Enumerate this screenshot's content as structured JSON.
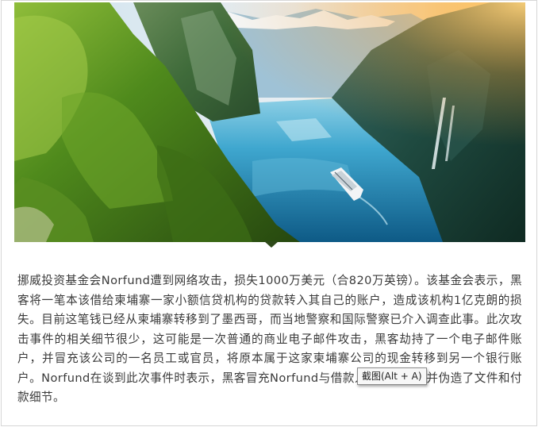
{
  "article": {
    "paragraph": "挪威投资基金会Norfund遭到网络攻击，损失1000万美元（合820万英镑）。该基金会表示，黑客将一笔本该借给柬埔寨一家小额信贷机构的贷款转入其自己的账户，造成该机构1亿克朗的损失。目前这笔钱已经从柬埔寨转移到了墨西哥，而当地警察和国际警察已介入调查此事。此次攻击事件的相关细节很少，这可能是一次普通的商业电子邮件攻击，黑客劫持了一个电子邮件账户，并冒充该公司的一名员工或官员，将原本属于这家柬埔寨公司的现金转移到另一个银行账户。Norfund在谈到此次事件时表示，黑客冒充Norfund与借款人交换信息，并伪造了文件和付款细节。"
  },
  "tooltip": {
    "label": "截图(Alt + A)"
  },
  "colors": {
    "text": "#3a3a3a",
    "border": "#d6d6d6",
    "tooltip_bg": "#f7f7f7"
  }
}
